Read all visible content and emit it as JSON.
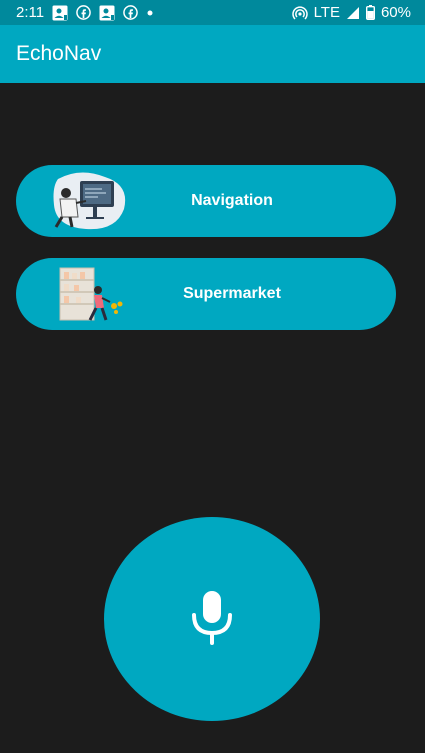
{
  "status_bar": {
    "time": "2:11",
    "network": "LTE",
    "battery": "60%",
    "icons": [
      "contact-card-icon",
      "facebook-icon",
      "contact-card-icon",
      "facebook-icon",
      "dot-icon",
      "hotspot-icon",
      "signal-icon",
      "battery-icon"
    ]
  },
  "app_bar": {
    "title": "EchoNav"
  },
  "menu": {
    "items": [
      {
        "label": "Navigation",
        "icon": "navigation-illustration"
      },
      {
        "label": "Supermarket",
        "icon": "supermarket-illustration"
      }
    ]
  },
  "mic": {
    "icon": "microphone-icon"
  },
  "colors": {
    "accent": "#00a8c1",
    "status_bar": "#00899c",
    "background": "#1c1c1c"
  }
}
